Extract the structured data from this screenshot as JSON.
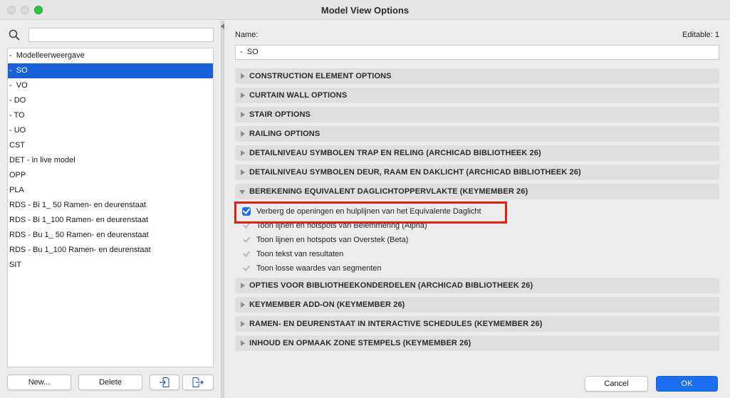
{
  "window": {
    "title": "Model View Options"
  },
  "search": {
    "placeholder": ""
  },
  "list": {
    "items": [
      "-  Modelleerweergave",
      "-  SO",
      "-  VO",
      "- DO",
      "- TO",
      "- UO",
      "CST",
      "DET - in live model",
      "OPP",
      "PLA",
      "RDS - Bi 1_ 50 Ramen- en deurenstaat",
      "RDS - Bi 1_100 Ramen- en deurenstaat",
      "RDS - Bu 1_ 50 Ramen- en deurenstaat",
      "RDS - Bu 1_100 Ramen- en deurenstaat",
      "SIT"
    ],
    "selected_index": 1
  },
  "left_buttons": {
    "new": "New...",
    "delete": "Delete"
  },
  "detail": {
    "name_label": "Name:",
    "editable": "Editable: 1",
    "name_value": "-  SO"
  },
  "sections": [
    {
      "label": "CONSTRUCTION ELEMENT OPTIONS",
      "expanded": false
    },
    {
      "label": "CURTAIN WALL OPTIONS",
      "expanded": false
    },
    {
      "label": "STAIR OPTIONS",
      "expanded": false
    },
    {
      "label": "RAILING OPTIONS",
      "expanded": false
    },
    {
      "label": "DETAILNIVEAU SYMBOLEN TRAP EN RELING (ARCHICAD BIBLIOTHEEK 26)",
      "expanded": false
    },
    {
      "label": "DETAILNIVEAU SYMBOLEN DEUR, RAAM EN DAKLICHT (ARCHICAD BIBLIOTHEEK 26)",
      "expanded": false
    },
    {
      "label": "BEREKENING EQUIVALENT DAGLICHTOPPERVLAKTE (KEYMEMBER 26)",
      "expanded": true
    },
    {
      "label": "OPTIES VOOR BIBLIOTHEEKONDERDELEN (ARCHICAD BIBLIOTHEEK 26)",
      "expanded": false
    },
    {
      "label": "KEYMEMBER ADD-ON (KEYMEMBER 26)",
      "expanded": false
    },
    {
      "label": "RAMEN- EN DEURENSTAAT IN INTERACTIVE SCHEDULES (KEYMEMBER 26)",
      "expanded": false
    },
    {
      "label": "INHOUD EN OPMAAK ZONE STEMPELS (KEYMEMBER 26)",
      "expanded": false
    }
  ],
  "options": [
    {
      "label": "Verberg de openingen en hulplijnen van het Equivalente Daglicht",
      "checked": true,
      "enabled": true
    },
    {
      "label": "Toon lijnen en hotspots van Belemmering (Alpha)",
      "checked": true,
      "enabled": false
    },
    {
      "label": "Toon lijnen en hotspots van Overstek (Beta)",
      "checked": true,
      "enabled": false
    },
    {
      "label": "Toon tekst van resultaten",
      "checked": true,
      "enabled": false
    },
    {
      "label": "Toon losse waardes van segmenten",
      "checked": true,
      "enabled": false
    }
  ],
  "footer": {
    "cancel": "Cancel",
    "ok": "OK"
  },
  "colors": {
    "accent": "#1a6ff0",
    "selection": "#1660d8",
    "highlight_box": "#e02010"
  }
}
